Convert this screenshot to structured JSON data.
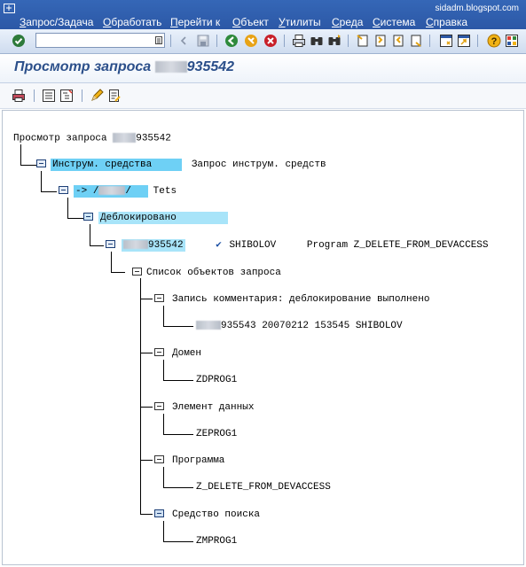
{
  "watermark": "sidadm.blogspot.com",
  "menu": {
    "items": [
      "Запрос/Задача",
      "Обработать",
      "Перейти к",
      "Объект",
      "Утилиты",
      "Среда",
      "Система",
      "Справка"
    ]
  },
  "toolbar": {
    "command_value": "",
    "icons": [
      "enter-icon",
      "dropdown-icon",
      "back-icon",
      "save-icon",
      "back-green-icon",
      "exit-icon",
      "cancel-icon",
      "print-icon",
      "find-icon",
      "find-next-icon",
      "first-page-icon",
      "prev-page-icon",
      "next-page-icon",
      "last-page-icon",
      "new-session-icon",
      "shortcut-icon",
      "help-icon",
      "customize-layout-icon"
    ]
  },
  "title": {
    "prefix": "Просмотр запроса",
    "suffix": "935542"
  },
  "tree": {
    "root": {
      "label": "Просмотр запроса",
      "suffix": "935542"
    },
    "tools": {
      "label": "Инструм. средства",
      "description": "Запрос инструм. средств"
    },
    "target": {
      "arrow": "->",
      "slash": "/",
      "slash2": "/",
      "description": "Tets"
    },
    "unlocked": {
      "label": "Деблокировано"
    },
    "request": {
      "suffix": "935542",
      "check": "✔",
      "owner": "SHIBOLOV",
      "text": "Program Z_DELETE_FROM_DEVACCESS"
    },
    "objects_list": {
      "label": "Список объектов запроса"
    },
    "comment": {
      "label": "Запись комментария: деблокирование выполнено",
      "child_suffix": "935543 20070212 153545 SHIBOLOV"
    },
    "domain": {
      "label": "Домен",
      "child": "ZDPROG1"
    },
    "data_element": {
      "label": "Элемент данных",
      "child": "ZEPROG1"
    },
    "program": {
      "label": "Программа",
      "child": "Z_DELETE_FROM_DEVACCESS"
    },
    "search_help": {
      "label": "Средство поиска",
      "child": "ZMPROG1"
    }
  }
}
